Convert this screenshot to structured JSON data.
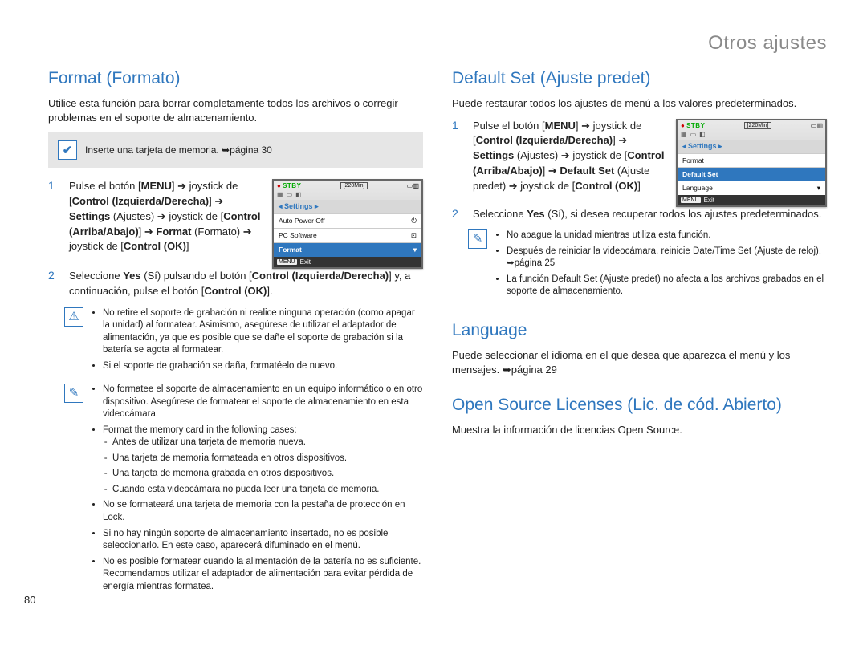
{
  "page_number": "80",
  "section_title": "Otros ajustes",
  "left": {
    "heading": "Format (Formato)",
    "intro": "Utilice esta función para borrar completamente todos los archivos o corregir problemas en el soporte de almacenamiento.",
    "memory_note": "Inserte una tarjeta de memoria. ➥página 30",
    "step1_pre": "Pulse el botón [",
    "step1_menu": "MENU",
    "step1_a": "] ➔ joystick de [",
    "step1_ctrl_lr": "Control (Izquierda/Derecha)",
    "step1_b": "] ➔ ",
    "step1_settings": "Settings",
    "step1_c": " (Ajustes) ➔ joystick de [",
    "step1_ctrl_ud": "Control (Arriba/Abajo)",
    "step1_d": "] ➔ ",
    "step1_format": "Format",
    "step1_e": " (Formato) ➔ joystick de [",
    "step1_ok": "Control (OK)",
    "step1_f": "]",
    "step2_a": "Seleccione ",
    "step2_yes": "Yes",
    "step2_b": " (Sí) pulsando el botón [",
    "step2_ctrl": "Control (Izquierda/Derecha)",
    "step2_c": "] y, a continuación, pulse el botón [",
    "step2_ok": "Control (OK)",
    "step2_d": "].",
    "warn_items": [
      "No retire el soporte de grabación ni realice ninguna operación (como apagar la unidad) al formatear. Asimismo, asegúrese de utilizar el adaptador de alimentación, ya que es posible que se dañe el soporte de grabación si la batería se agota al formatear.",
      "Si el soporte de grabación se daña, formatéelo de nuevo."
    ],
    "info_items": [
      "No formatee el soporte de almacenamiento en un equipo informático o en otro dispositivo. Asegúrese de formatear el soporte de almacenamiento en esta videocámara.",
      "Format the memory card in the following cases:",
      "No se formateará una tarjeta de memoria con la pestaña de protección en Lock.",
      "Si no hay ningún soporte de almacenamiento insertado, no es posible seleccionarlo. En este caso, aparecerá difuminado en el menú.",
      "No es posible formatear cuando la alimentación de la batería no es suficiente. Recomendamos utilizar el adaptador de alimentación para evitar pérdida de energía mientras formatea."
    ],
    "info_subitems": [
      "Antes de utilizar una tarjeta de memoria nueva.",
      "Una tarjeta de memoria formateada en otros dispositivos.",
      "Una tarjeta de memoria grabada en otros dispositivos.",
      "Cuando esta videocámara no pueda leer una tarjeta de memoria."
    ]
  },
  "right": {
    "heading1": "Default Set (Ajuste predet)",
    "intro1": "Puede restaurar todos los ajustes de menú a los valores predeterminados.",
    "r_step1_pre": "Pulse el botón [",
    "r_step1_menu": "MENU",
    "r_step1_a": "] ➔ joystick de [",
    "r_step1_ctrl_lr": "Control (Izquierda/Derecha)",
    "r_step1_b": "] ➔ ",
    "r_step1_settings": "Settings",
    "r_step1_c": " (Ajustes) ➔ joystick de [",
    "r_step1_ctrl_ud": "Control (Arriba/Abajo)",
    "r_step1_d": "] ➔ ",
    "r_step1_default": "Default Set",
    "r_step1_e": " (Ajuste predet) ➔ joystick de [",
    "r_step1_ok": "Control (OK)",
    "r_step1_f": "]",
    "r_step2_a": "Seleccione ",
    "r_step2_yes": "Yes",
    "r_step2_b": " (Sí), si desea recuperar todos los ajustes predeterminados.",
    "info_items": [
      "No apague la unidad mientras utiliza esta función.",
      "Después de reiniciar la videocámara, reinicie Date/Time Set (Ajuste de reloj). ➥página 25",
      "La función Default Set (Ajuste predet) no afecta a los archivos grabados en el soporte de almacenamiento."
    ],
    "heading2": "Language",
    "intro2": "Puede seleccionar el idioma en el que desea que aparezca el menú y los mensajes. ➥página 29",
    "heading3": "Open Source Licenses (Lic. de cód. Abierto)",
    "intro3": "Muestra la información de licencias Open Source."
  },
  "lcd1": {
    "stby": "STBY",
    "time": "[220Min]",
    "hdr": "Settings",
    "items": [
      "Auto Power Off",
      "PC Software",
      "Format"
    ],
    "selected_index": 2,
    "exit": "Exit",
    "menu": "MENU"
  },
  "lcd2": {
    "stby": "STBY",
    "time": "[220Min]",
    "hdr": "Settings",
    "items": [
      "Format",
      "Default Set",
      "Language"
    ],
    "selected_index": 1,
    "exit": "Exit",
    "menu": "MENU"
  }
}
